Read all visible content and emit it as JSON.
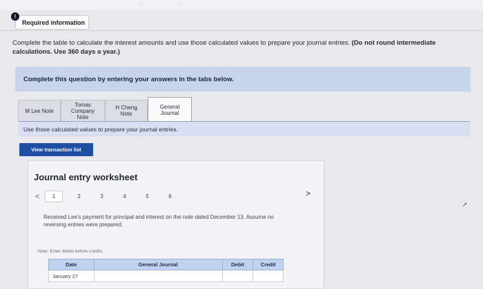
{
  "alert": {
    "glyph": "!"
  },
  "header": {
    "title": "Required information"
  },
  "instructions": {
    "text": "Complete the table to calculate the interest amounts and use those calculated values to prepare your journal entries.",
    "bold": "(Do not round intermediate calculations. Use 360 days a year.)"
  },
  "banner": {
    "text": "Complete this question by entering your answers in the tabs below."
  },
  "tabs": [
    {
      "label": "M Lee Note"
    },
    {
      "label": "Tomas Company Note"
    },
    {
      "label": "H Cheng Note"
    },
    {
      "label": "General Journal"
    }
  ],
  "subbar": {
    "text": "Use those calculated values to prepare your journal entries."
  },
  "buttons": {
    "view_transactions": "View transaction list"
  },
  "worksheet": {
    "title": "Journal entry worksheet",
    "pages": [
      "1",
      "2",
      "3",
      "4",
      "5",
      "6"
    ],
    "prev_icon": "<",
    "next_icon": ">",
    "entry_description": "Received Lee's payment for principal and interest on the note dated December 13. Assume no reversing entries were prepared.",
    "note": "Note: Enter debits before credits.",
    "table": {
      "columns": [
        "Date",
        "General Journal",
        "Debit",
        "Credit"
      ],
      "rows": [
        {
          "date": "January 27",
          "account": "",
          "debit": "",
          "credit": ""
        }
      ]
    }
  },
  "colors": {
    "primary_button": "#1e4fa3",
    "banner": "#c7d4ec",
    "table_header": "#bfd3f0"
  }
}
